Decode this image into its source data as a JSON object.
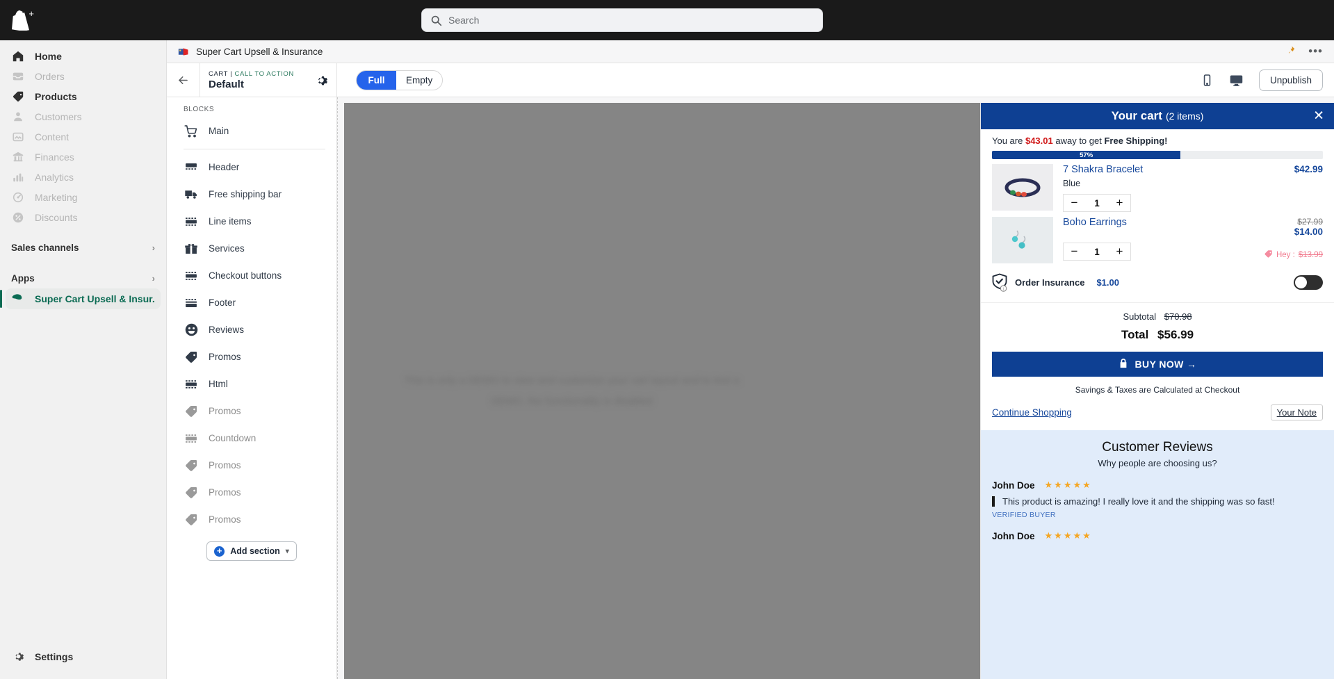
{
  "topbar": {
    "logo_name": "shopify-logo",
    "search": {
      "placeholder": "Search",
      "value": "",
      "icon": "search-icon"
    }
  },
  "admin_nav": {
    "items": [
      {
        "label": "Home",
        "icon": "home-icon",
        "active": true
      },
      {
        "label": "Orders",
        "icon": "orders-icon",
        "active": false
      },
      {
        "label": "Products",
        "icon": "products-tag-icon",
        "active": true
      },
      {
        "label": "Customers",
        "icon": "customers-icon",
        "active": false
      },
      {
        "label": "Content",
        "icon": "content-icon",
        "active": false
      },
      {
        "label": "Finances",
        "icon": "finances-bank-icon",
        "active": false
      },
      {
        "label": "Analytics",
        "icon": "analytics-bars-icon",
        "active": false
      },
      {
        "label": "Marketing",
        "icon": "marketing-icon",
        "active": false
      },
      {
        "label": "Discounts",
        "icon": "discounts-icon",
        "active": false
      }
    ],
    "groups": [
      {
        "label": "Sales channels",
        "icon": "chevron-right-icon"
      },
      {
        "label": "Apps",
        "icon": "chevron-right-icon"
      }
    ],
    "active_app": {
      "label": "Super Cart Upsell & Insur...",
      "icon": "app-icon"
    },
    "settings": {
      "label": "Settings",
      "icon": "gear-icon"
    }
  },
  "editor_titlebar": {
    "app_title": "Super Cart Upsell & Insurance",
    "pin_icon": "pin-icon",
    "more_icon": "more-horizontal-icon"
  },
  "blocks_panel": {
    "back_icon": "arrow-left-icon",
    "breadcrumb_primary": "CART |",
    "breadcrumb_accent": "CALL TO ACTION",
    "name": "Default",
    "gear_icon": "gear-icon",
    "section_label": "BLOCKS",
    "main_block": {
      "label": "Main",
      "icon": "cart-icon"
    },
    "items": [
      {
        "label": "Header",
        "icon": "header-block-icon",
        "dim": false
      },
      {
        "label": "Free shipping bar",
        "icon": "truck-icon",
        "dim": false
      },
      {
        "label": "Line items",
        "icon": "line-items-icon",
        "dim": false
      },
      {
        "label": "Services",
        "icon": "gift-icon",
        "dim": false
      },
      {
        "label": "Checkout buttons",
        "icon": "checkout-buttons-icon",
        "dim": false
      },
      {
        "label": "Footer",
        "icon": "footer-block-icon",
        "dim": false
      },
      {
        "label": "Reviews",
        "icon": "smiley-icon",
        "dim": false
      },
      {
        "label": "Promos",
        "icon": "tag-icon",
        "dim": false
      },
      {
        "label": "Html",
        "icon": "html-block-icon",
        "dim": false
      },
      {
        "label": "Promos",
        "icon": "tag-icon",
        "dim": true
      },
      {
        "label": "Countdown",
        "icon": "countdown-icon",
        "dim": true
      },
      {
        "label": "Promos",
        "icon": "tag-icon",
        "dim": true
      },
      {
        "label": "Promos",
        "icon": "tag-icon",
        "dim": true
      },
      {
        "label": "Promos",
        "icon": "tag-icon",
        "dim": true
      }
    ],
    "add_section": {
      "label": "Add section",
      "plus_icon": "plus-icon",
      "chevron": "chevron-down-icon"
    }
  },
  "preview_toolbar": {
    "tabs": [
      {
        "label": "Full",
        "active": true
      },
      {
        "label": "Empty",
        "active": false
      }
    ],
    "mobile_icon": "mobile-icon",
    "desktop_icon": "desktop-icon",
    "unpublish_label": "Unpublish"
  },
  "preview": {
    "placeholder_text": "This is only a DEMO to view and customize your cart layout and to test a DEMO, the functionality is disabled"
  },
  "cart": {
    "title": "Your cart",
    "items_count": "(2 items)",
    "close_icon": "close-icon",
    "shipping": {
      "prefix": "You are",
      "amount": "$43.01",
      "middle": "away to get",
      "bold_suffix": "Free Shipping!",
      "progress_pct": "57%",
      "progress_value": 57
    },
    "line_items": [
      {
        "title": "7 Shakra Bracelet",
        "variant": "Blue",
        "price": "$42.99",
        "compare_at": "",
        "quantity": "1",
        "minus": "−",
        "plus": "+",
        "promo_label": "",
        "promo_price": "",
        "thumb_name": "bracelet-thumbnail"
      },
      {
        "title": "Boho Earrings",
        "variant": "",
        "price": "$14.00",
        "compare_at": "$27.99",
        "quantity": "1",
        "minus": "−",
        "plus": "+",
        "promo_label": "Hey :",
        "promo_price": "$13.99",
        "thumb_name": "earrings-thumbnail"
      }
    ],
    "insurance": {
      "label": "Order Insurance",
      "price": "$1.00",
      "icon": "shield-check-icon",
      "info_icon": "info-icon",
      "toggle_on": false
    },
    "subtotal_label": "Subtotal",
    "subtotal_value": "$70.98",
    "total_label": "Total",
    "total_value": "$56.99",
    "buy_button": {
      "label": "BUY NOW →",
      "lock_icon": "lock-icon"
    },
    "savings_note": "Savings & Taxes are Calculated at Checkout",
    "continue_shopping": "Continue Shopping",
    "your_note": "Your Note"
  },
  "reviews": {
    "title": "Customer Reviews",
    "subtitle": "Why people are choosing us?",
    "entries": [
      {
        "name": "John Doe",
        "stars": "★★★★★",
        "text": "This product is amazing! I really love it and the shipping was so fast!",
        "verified": "VERIFIED BUYER"
      },
      {
        "name": "John Doe",
        "stars": "★★★★★",
        "text": "",
        "verified": ""
      }
    ]
  },
  "colors": {
    "brand_blue": "#0e4093",
    "accent_blue": "#2563eb",
    "link_blue": "#18499c",
    "red": "#d01919",
    "green": "#0b6b53",
    "star": "#f5a623",
    "pink": "#f17a8e",
    "reviews_bg": "#e1ecfa"
  }
}
